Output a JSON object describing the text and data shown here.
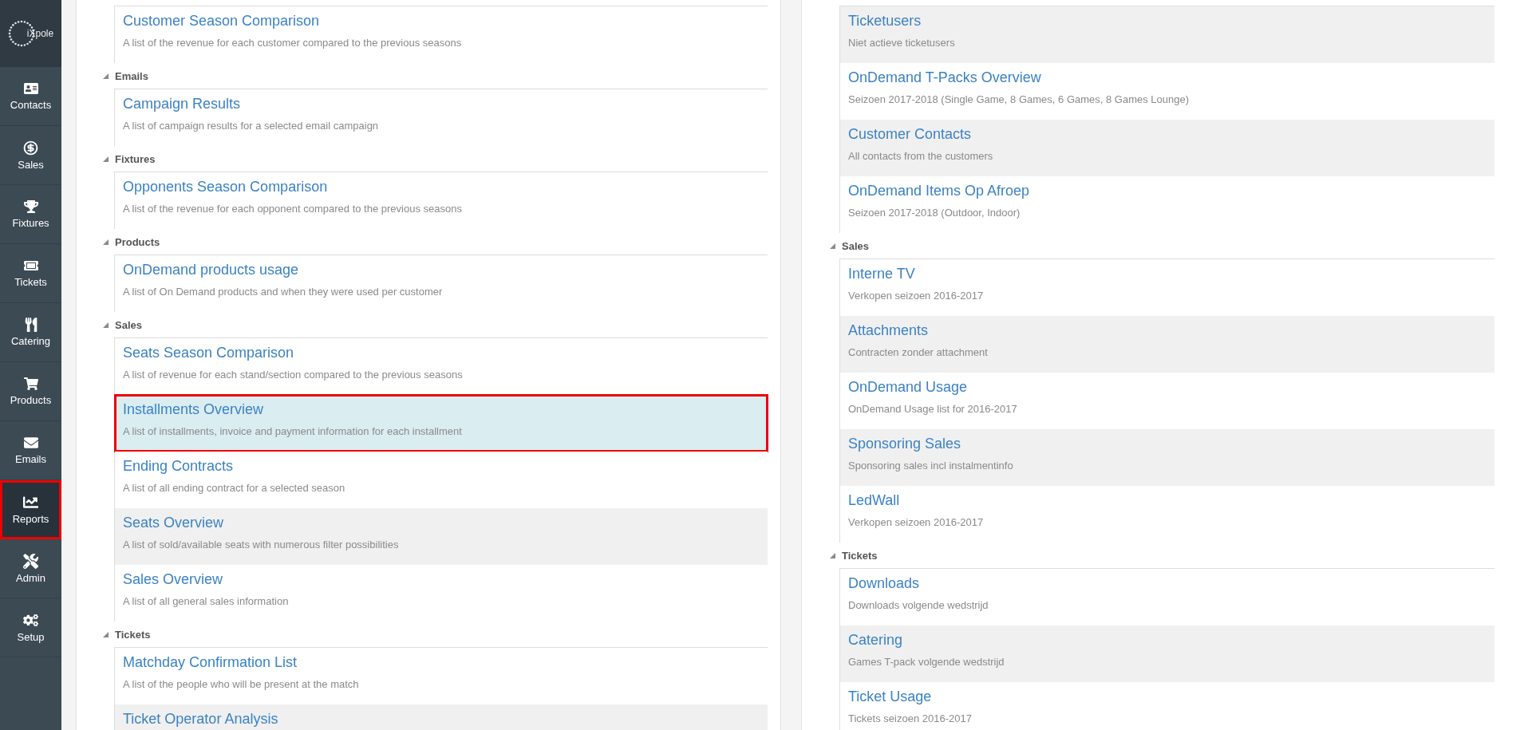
{
  "sidebar": {
    "logo": "iXpole",
    "items": [
      {
        "label": "Contacts",
        "selected": false
      },
      {
        "label": "Sales",
        "selected": false
      },
      {
        "label": "Fixtures",
        "selected": false
      },
      {
        "label": "Tickets",
        "selected": false
      },
      {
        "label": "Catering",
        "selected": false
      },
      {
        "label": "Products",
        "selected": false
      },
      {
        "label": "Emails",
        "selected": false
      },
      {
        "label": "Reports",
        "selected": true
      },
      {
        "label": "Admin",
        "selected": false
      },
      {
        "label": "Setup",
        "selected": false
      }
    ]
  },
  "columns": [
    {
      "groups": [
        {
          "reports": [
            {
              "title": "Customer Season Comparison",
              "description": "A list of the revenue for each customer compared to the previous seasons",
              "shaded": false,
              "selected": false
            }
          ]
        },
        {
          "heading": "Emails",
          "expanded": true,
          "reports": [
            {
              "title": "Campaign Results",
              "description": "A list of campaign results for a selected email campaign",
              "shaded": false,
              "selected": false
            }
          ]
        },
        {
          "heading": "Fixtures",
          "expanded": true,
          "reports": [
            {
              "title": "Opponents Season Comparison",
              "description": "A list of the revenue for each opponent compared to the previous seasons",
              "shaded": false,
              "selected": false
            }
          ]
        },
        {
          "heading": "Products",
          "expanded": true,
          "reports": [
            {
              "title": "OnDemand products usage",
              "description": "A list of On Demand products and when they were used per customer",
              "shaded": false,
              "selected": false
            }
          ]
        },
        {
          "heading": "Sales",
          "expanded": true,
          "reports": [
            {
              "title": "Seats Season Comparison",
              "description": "A list of revenue for each stand/section compared to the previous seasons",
              "shaded": false,
              "selected": false
            },
            {
              "title": "Installments Overview",
              "description": "A list of installments, invoice and payment information for each installment",
              "shaded": true,
              "selected": true
            },
            {
              "title": "Ending Contracts",
              "description": "A list of all ending contract for a selected season",
              "shaded": false,
              "selected": false
            },
            {
              "title": "Seats Overview",
              "description": "A list of sold/available seats with numerous filter possibilities",
              "shaded": true,
              "selected": false
            },
            {
              "title": "Sales Overview",
              "description": "A list of all general sales information",
              "shaded": false,
              "selected": false
            }
          ]
        },
        {
          "heading": "Tickets",
          "expanded": true,
          "reports": [
            {
              "title": "Matchday Confirmation List",
              "description": "A list of the people who will be present at the match",
              "shaded": false,
              "selected": false
            },
            {
              "title": "Ticket Operator Analysis",
              "shaded": true,
              "selected": false
            }
          ]
        }
      ]
    },
    {
      "groups": [
        {
          "reports": [
            {
              "title": "Ticketusers",
              "description": "Niet actieve ticketusers",
              "shaded": true,
              "selected": false
            },
            {
              "title": "OnDemand T-Packs Overview",
              "description": "Seizoen 2017-2018 (Single Game, 8 Games, 6 Games, 8 Games Lounge)",
              "shaded": false,
              "selected": false
            },
            {
              "title": "Customer Contacts",
              "description": "All contacts from the customers",
              "shaded": true,
              "selected": false
            },
            {
              "title": "OnDemand Items Op Afroep",
              "description": "Seizoen 2017-2018 (Outdoor, Indoor)",
              "shaded": false,
              "selected": false
            }
          ]
        },
        {
          "heading": "Sales",
          "expanded": true,
          "reports": [
            {
              "title": "Interne TV",
              "description": "Verkopen seizoen 2016-2017",
              "shaded": false,
              "selected": false
            },
            {
              "title": "Attachments",
              "description": "Contracten zonder attachment",
              "shaded": true,
              "selected": false
            },
            {
              "title": "OnDemand Usage",
              "description": "OnDemand Usage list for 2016-2017",
              "shaded": false,
              "selected": false
            },
            {
              "title": "Sponsoring Sales",
              "description": "Sponsoring sales incl instalmentinfo",
              "shaded": true,
              "selected": false
            },
            {
              "title": "LedWall",
              "description": "Verkopen seizoen 2016-2017",
              "shaded": false,
              "selected": false
            }
          ]
        },
        {
          "heading": "Tickets",
          "expanded": true,
          "reports": [
            {
              "title": "Downloads",
              "description": "Downloads volgende wedstrijd",
              "shaded": false,
              "selected": false
            },
            {
              "title": "Catering",
              "description": "Games T-pack volgende wedstrijd",
              "shaded": true,
              "selected": false
            },
            {
              "title": "Ticket Usage",
              "description": "Tickets seizoen 2016-2017",
              "shaded": false,
              "selected": false
            }
          ]
        }
      ]
    }
  ]
}
